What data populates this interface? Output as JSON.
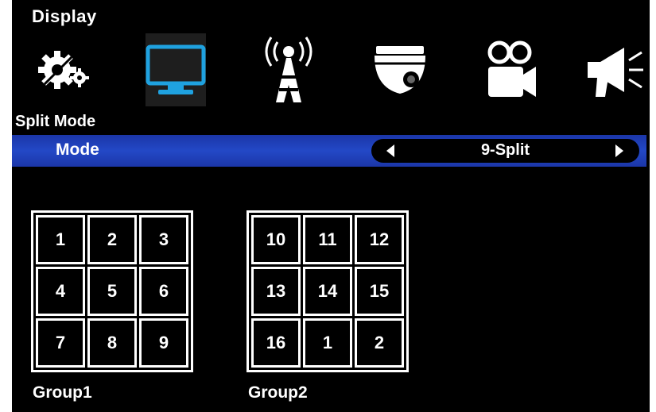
{
  "header": {
    "title": "Display"
  },
  "toolbar": {
    "icons": [
      {
        "name": "settings-gears-icon",
        "active": false
      },
      {
        "name": "monitor-icon",
        "active": true
      },
      {
        "name": "antenna-tower-icon",
        "active": false
      },
      {
        "name": "dome-camera-icon",
        "active": false
      },
      {
        "name": "video-camera-icon",
        "active": false
      },
      {
        "name": "megaphone-icon",
        "active": false
      }
    ],
    "accent_color": "#1fa2e0"
  },
  "section": {
    "title": "Split Mode"
  },
  "mode_row": {
    "label": "Mode",
    "value": "9-Split",
    "highlight_color": "#2347c4"
  },
  "groups": [
    {
      "label": "Group1",
      "cells": [
        "1",
        "2",
        "3",
        "4",
        "5",
        "6",
        "7",
        "8",
        "9"
      ]
    },
    {
      "label": "Group2",
      "cells": [
        "10",
        "11",
        "12",
        "13",
        "14",
        "15",
        "16",
        "1",
        "2"
      ]
    }
  ]
}
